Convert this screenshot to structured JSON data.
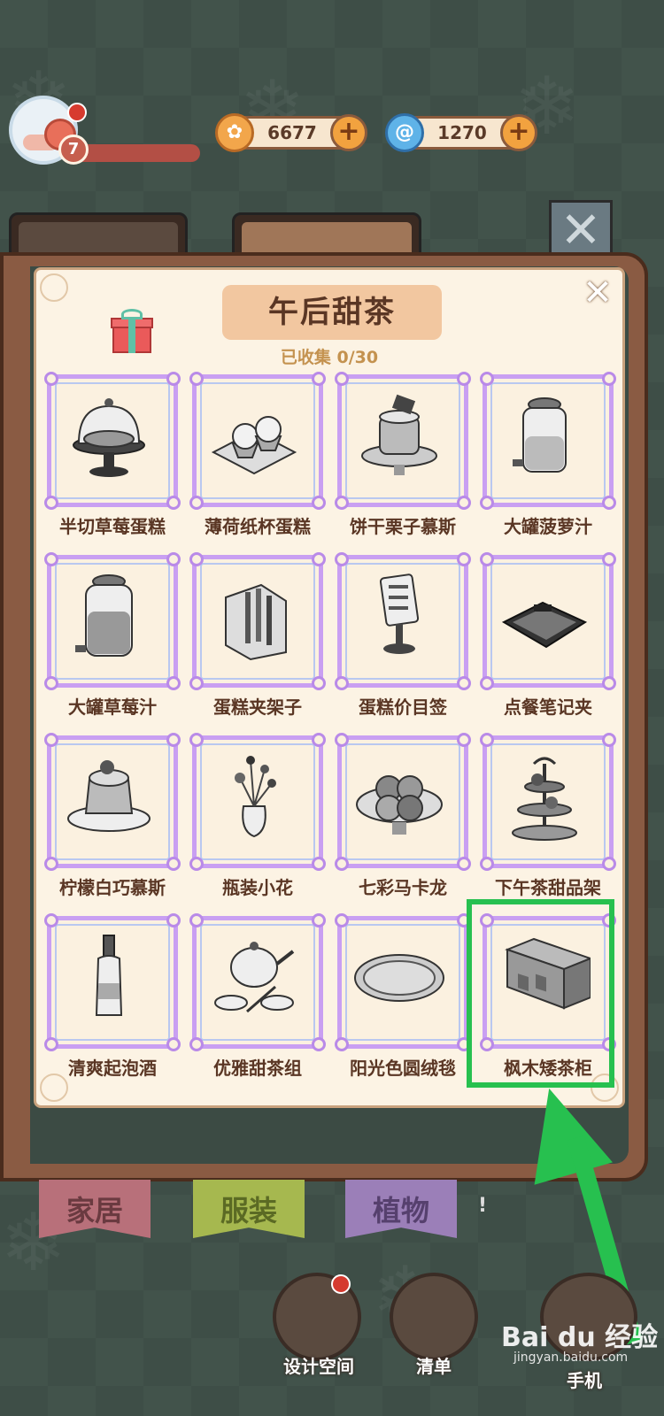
{
  "player": {
    "level": "7"
  },
  "currency": {
    "coins": "6677",
    "gems": "1270"
  },
  "panel": {
    "title": "午后甜茶",
    "collected": "已收集 0/30",
    "close_symbol": "✕"
  },
  "items": [
    {
      "label": "半切草莓蛋糕",
      "icon": "cake-stand-icon"
    },
    {
      "label": "薄荷纸杯蛋糕",
      "icon": "cupcake-tray-icon"
    },
    {
      "label": "饼干栗子慕斯",
      "icon": "mousse-cake-icon"
    },
    {
      "label": "大罐菠萝汁",
      "icon": "juice-jar-icon"
    },
    {
      "label": "大罐草莓汁",
      "icon": "juice-jar-icon"
    },
    {
      "label": "蛋糕夹架子",
      "icon": "utensil-holder-icon"
    },
    {
      "label": "蛋糕价目签",
      "icon": "price-sign-icon"
    },
    {
      "label": "点餐笔记夹",
      "icon": "clipboard-icon"
    },
    {
      "label": "柠檬白巧慕斯",
      "icon": "pudding-icon"
    },
    {
      "label": "瓶装小花",
      "icon": "flower-vase-icon"
    },
    {
      "label": "七彩马卡龙",
      "icon": "macaron-plate-icon"
    },
    {
      "label": "下午茶甜品架",
      "icon": "tiered-stand-icon"
    },
    {
      "label": "清爽起泡酒",
      "icon": "wine-bottle-icon"
    },
    {
      "label": "优雅甜茶组",
      "icon": "teapot-set-icon"
    },
    {
      "label": "阳光色圆绒毯",
      "icon": "round-rug-icon"
    },
    {
      "label": "枫木矮茶柜",
      "icon": "low-cabinet-icon"
    }
  ],
  "bottom_tabs": [
    {
      "label": "家居",
      "color": "#b8707a"
    },
    {
      "label": "服装",
      "color": "#a6b84f"
    },
    {
      "label": "植物",
      "color": "#9b7fb8"
    }
  ],
  "bottom_tab_extra": "!",
  "bottom_buttons": [
    {
      "label": "设计空间"
    },
    {
      "label": "清单"
    },
    {
      "label": "手机"
    }
  ],
  "watermark": {
    "brand": "Bai du 经验",
    "url": "jingyan.baidu.com"
  },
  "colors": {
    "highlight": "#27c04f",
    "frame": "#c99ff2",
    "panel_bg": "#fcf3e4"
  }
}
